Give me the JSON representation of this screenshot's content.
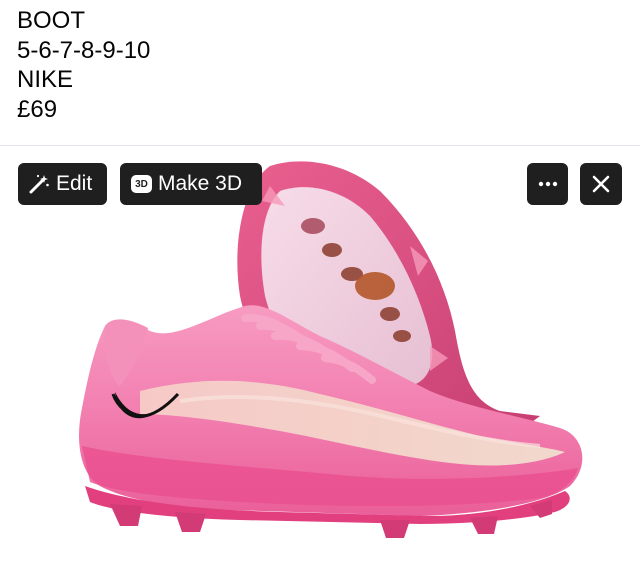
{
  "post": {
    "lines": [
      "BOOT",
      "5-6-7-8-9-10",
      "NIKE",
      "£69"
    ]
  },
  "photo": {
    "alt": "Pink Nike football boot"
  },
  "toolbar": {
    "edit_label": "Edit",
    "make3d_label": "Make 3D",
    "make3d_badge": "3D",
    "more_icon": "ellipsis-icon",
    "close_icon": "close-icon",
    "edit_icon": "magic-wand-icon",
    "button_bg": "#1f1f1f"
  },
  "colors": {
    "boot_main": "#f06fa7",
    "boot_light": "#f7a8c8",
    "boot_dark": "#d9457f",
    "stripe": "#f3d4c4",
    "swoosh": "#111111"
  }
}
